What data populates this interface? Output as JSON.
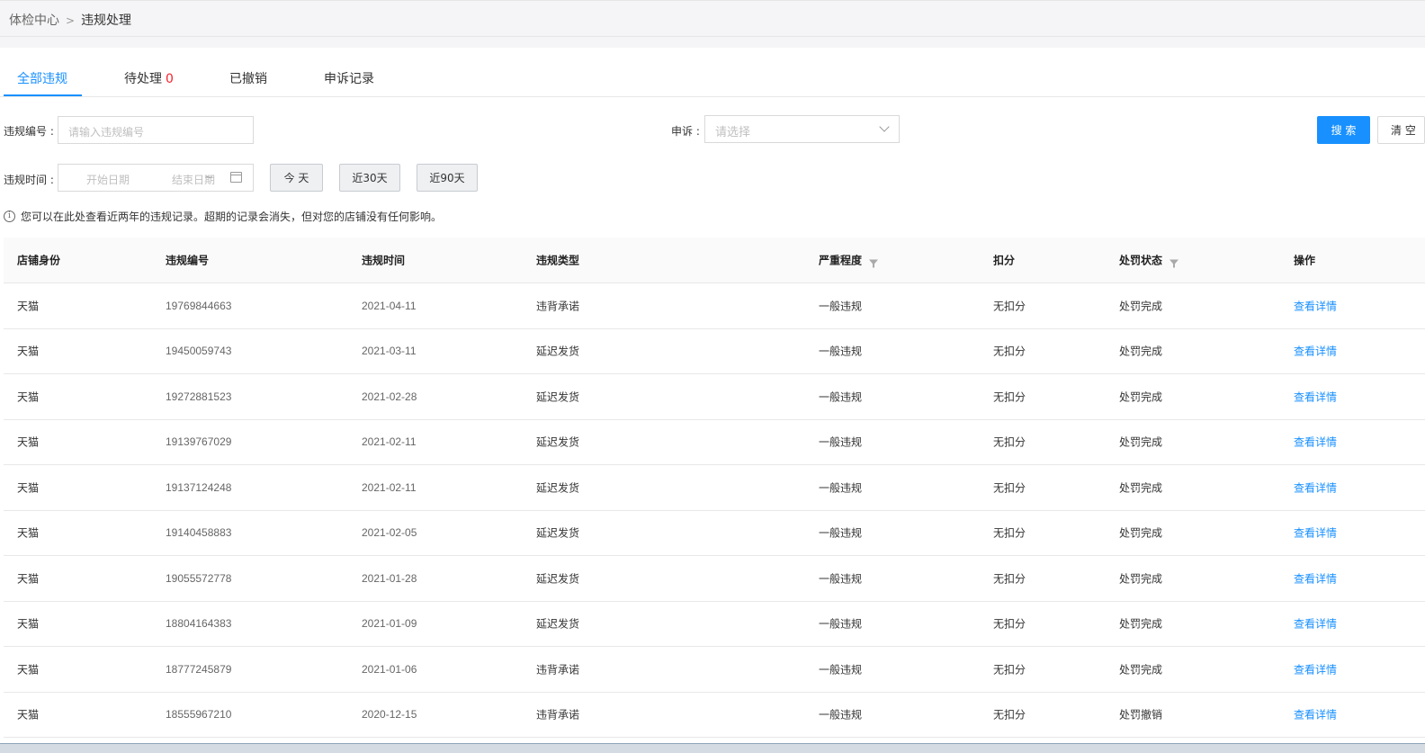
{
  "breadcrumb": {
    "parent": "体检中心",
    "separator": ">",
    "current": "违规处理"
  },
  "tabs": [
    {
      "label": "全部违规"
    },
    {
      "label": "待处理",
      "count": "0"
    },
    {
      "label": "已撤销"
    },
    {
      "label": "申诉记录"
    }
  ],
  "filters": {
    "violation_no_label": "违规编号",
    "violation_no_placeholder": "请输入违规编号",
    "appeal_label": "申诉",
    "appeal_placeholder": "请选择",
    "time_label": "违规时间",
    "start_placeholder": "开始日期",
    "date_sep": "~",
    "end_placeholder": "结束日期",
    "today": "今 天",
    "last30": "近30天",
    "last90": "近90天",
    "search": "搜 索",
    "clear": "清 空"
  },
  "notice": "您可以在此处查看近两年的违规记录。超期的记录会消失，但对您的店铺没有任何影响。",
  "table": {
    "headers": [
      "店铺身份",
      "违规编号",
      "违规时间",
      "违规类型",
      "严重程度",
      "扣分",
      "处罚状态",
      "操作"
    ],
    "rows": [
      [
        "天猫",
        "19769844663",
        "2021-04-11",
        "违背承诺",
        "一般违规",
        "无扣分",
        "处罚完成",
        "查看详情"
      ],
      [
        "天猫",
        "19450059743",
        "2021-03-11",
        "延迟发货",
        "一般违规",
        "无扣分",
        "处罚完成",
        "查看详情"
      ],
      [
        "天猫",
        "19272881523",
        "2021-02-28",
        "延迟发货",
        "一般违规",
        "无扣分",
        "处罚完成",
        "查看详情"
      ],
      [
        "天猫",
        "19139767029",
        "2021-02-11",
        "延迟发货",
        "一般违规",
        "无扣分",
        "处罚完成",
        "查看详情"
      ],
      [
        "天猫",
        "19137124248",
        "2021-02-11",
        "延迟发货",
        "一般违规",
        "无扣分",
        "处罚完成",
        "查看详情"
      ],
      [
        "天猫",
        "19140458883",
        "2021-02-05",
        "延迟发货",
        "一般违规",
        "无扣分",
        "处罚完成",
        "查看详情"
      ],
      [
        "天猫",
        "19055572778",
        "2021-01-28",
        "延迟发货",
        "一般违规",
        "无扣分",
        "处罚完成",
        "查看详情"
      ],
      [
        "天猫",
        "18804164383",
        "2021-01-09",
        "延迟发货",
        "一般违规",
        "无扣分",
        "处罚完成",
        "查看详情"
      ],
      [
        "天猫",
        "18777245879",
        "2021-01-06",
        "违背承诺",
        "一般违规",
        "无扣分",
        "处罚完成",
        "查看详情"
      ],
      [
        "天猫",
        "18555967210",
        "2020-12-15",
        "违背承诺",
        "一般违规",
        "无扣分",
        "处罚撤销",
        "查看详情"
      ]
    ]
  },
  "colors": {
    "accent": "#1890ff",
    "count_red": "#f5222d"
  },
  "icons": {
    "info": "info-circle-icon",
    "calendar": "calendar-icon",
    "filter": "filter-icon",
    "dropdown": "chevron-down-icon"
  }
}
